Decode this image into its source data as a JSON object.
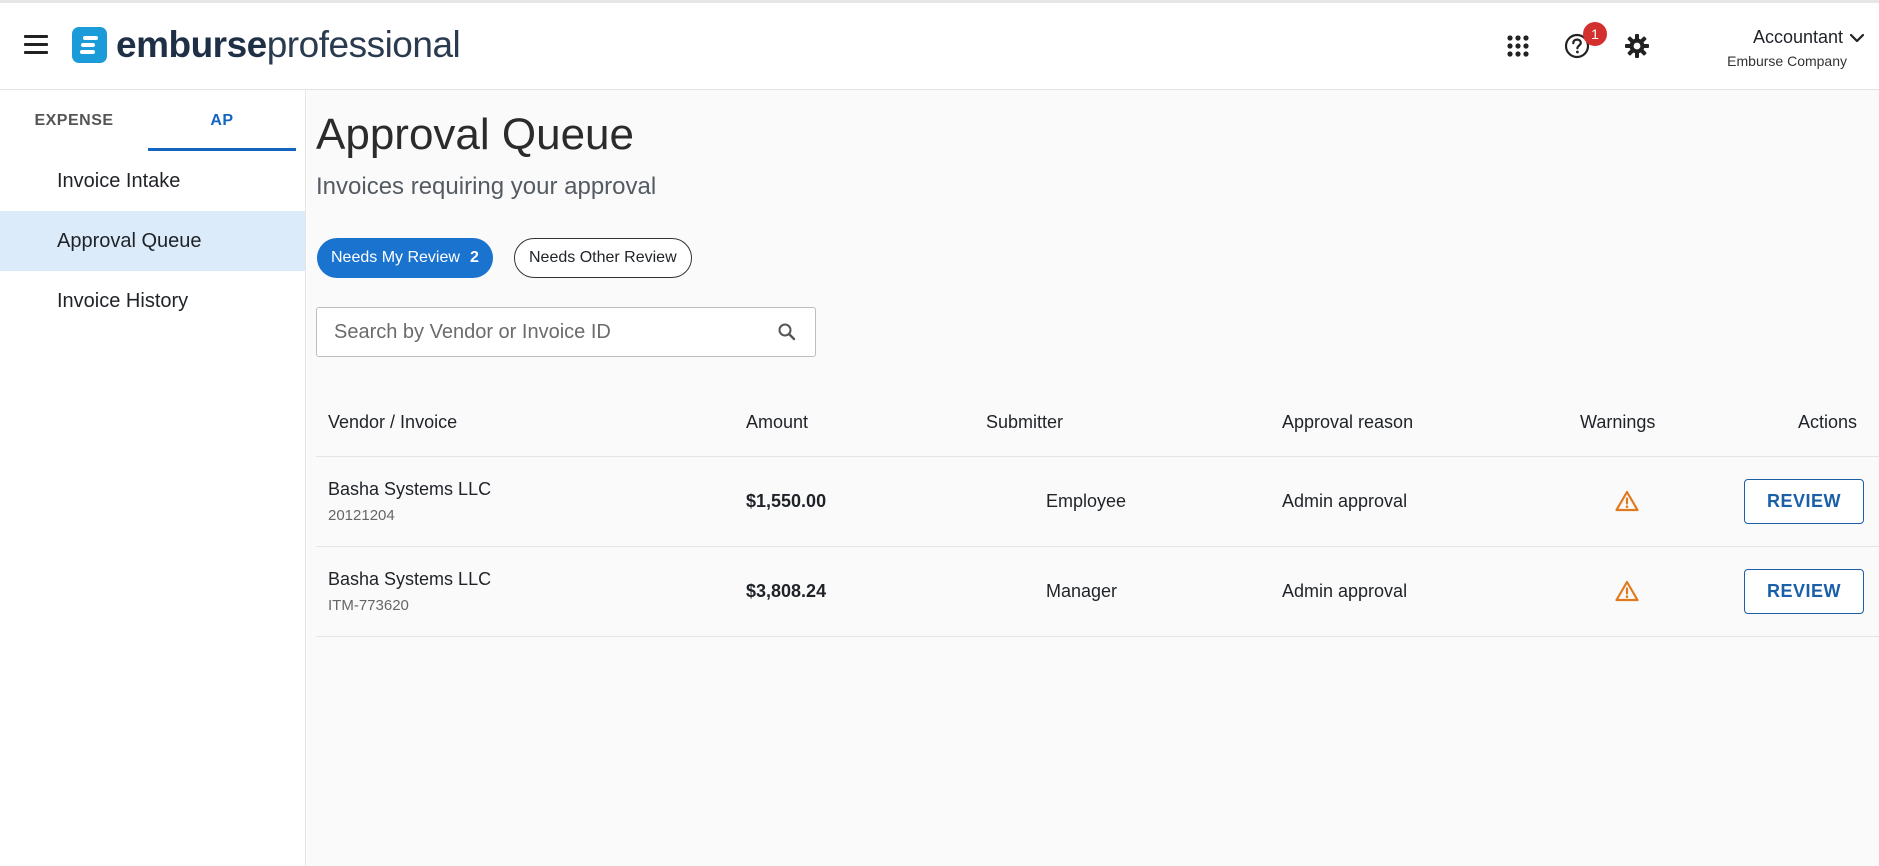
{
  "header": {
    "logo_part1": "emburse",
    "logo_part2": "professional",
    "help_badge": "1",
    "account_role": "Accountant",
    "account_company": "Emburse Company"
  },
  "sidebar": {
    "tabs": [
      {
        "label": "EXPENSE"
      },
      {
        "label": "AP"
      }
    ],
    "items": [
      {
        "label": "Invoice Intake"
      },
      {
        "label": "Approval Queue"
      },
      {
        "label": "Invoice History"
      }
    ]
  },
  "main": {
    "title": "Approval Queue",
    "subtitle": "Invoices requiring your approval",
    "filters": {
      "mine_label": "Needs My Review",
      "mine_count": "2",
      "other_label": "Needs Other Review"
    },
    "search": {
      "placeholder": "Search by Vendor or Invoice ID",
      "value": ""
    },
    "table": {
      "columns": [
        "Vendor / Invoice",
        "Amount",
        "Submitter",
        "Approval reason",
        "Warnings",
        "Actions"
      ],
      "rows": [
        {
          "vendor": "Basha Systems LLC",
          "invoice_id": "20121204",
          "amount": "$1,550.00",
          "submitter": "Employee",
          "reason": "Admin approval",
          "action": "REVIEW"
        },
        {
          "vendor": "Basha Systems LLC",
          "invoice_id": "ITM-773620",
          "amount": "$3,808.24",
          "submitter": "Manager",
          "reason": "Admin approval",
          "action": "REVIEW"
        }
      ]
    }
  },
  "colors": {
    "brand": "#1b9bd8",
    "accent": "#1a73cf",
    "active_nav_bg": "#dcebfa",
    "warning": "#e07a1f",
    "badge": "#d32f2f"
  },
  "icons": [
    "menu-icon",
    "emburse-logo-mark",
    "apps-grid-icon",
    "help-icon",
    "gear-icon",
    "chevron-down-icon",
    "search-icon",
    "warning-icon"
  ]
}
